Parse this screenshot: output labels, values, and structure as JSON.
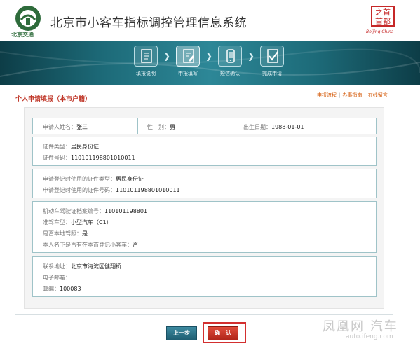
{
  "header": {
    "logo_caption": "北京交通",
    "system_title": "北京市小客车指标调控管理信息系统",
    "seal_text": "之首\n首都",
    "seal_caption": "Beijing China"
  },
  "steps": [
    {
      "label": "填报说明",
      "active": false,
      "icon": "document-icon"
    },
    {
      "label": "申报填写",
      "active": true,
      "icon": "edit-icon"
    },
    {
      "label": "短信确认",
      "active": false,
      "icon": "phone-icon"
    },
    {
      "label": "完成申请",
      "active": false,
      "icon": "checkmark-icon"
    }
  ],
  "panel": {
    "title": "个人申请填报（本市户籍）",
    "links": [
      "申报流程",
      "办事指南",
      "在线留言"
    ]
  },
  "section1": {
    "name_label": "申请人姓名：",
    "name_value": "张三",
    "gender_label": "性　别：",
    "gender_value": "男",
    "birth_label": "出生日期：",
    "birth_value": "1988-01-01"
  },
  "section2": {
    "idtype_label": "证件类型：",
    "idtype_value": "居民身份证",
    "idnum_label": "证件号码：",
    "idnum_value": "110101198801010011"
  },
  "section3": {
    "regtype_label": "申请登记时使用的证件类型：",
    "regtype_value": "居民身份证",
    "regnum_label": "申请登记时使用的证件号码：",
    "regnum_value": "110101198801010011"
  },
  "section4": {
    "license_label": "机动车驾驶证档案编号：",
    "license_value": "110101198801",
    "class_label": "准驾车型：",
    "class_value": "小型汽车（C1）",
    "local_label": "是否本地驾照：",
    "local_value": "是",
    "hascar_label": "本人名下是否有在本市登记小客车：",
    "hascar_value": "否"
  },
  "section5": {
    "address_label": "联系地址：",
    "address_value": "北京市海淀区健翔桥",
    "email_label": "电子邮箱：",
    "email_value": "",
    "zip_label": "邮编：",
    "zip_value": "100083"
  },
  "buttons": {
    "prev": "上一步",
    "confirm": "确　认"
  },
  "watermark": {
    "main": "凤凰网 汽车",
    "sub": "auto.ifeng.com"
  },
  "colors": {
    "banner": "#1d6b79",
    "accent_red": "#d32f2f",
    "border": "#9fc3c8"
  }
}
